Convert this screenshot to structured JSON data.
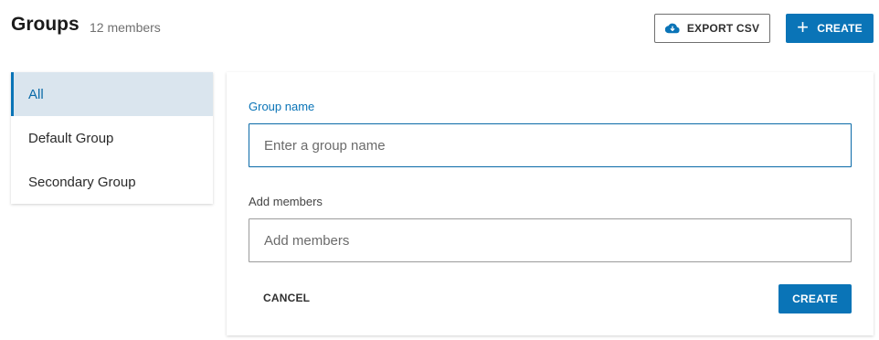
{
  "header": {
    "title": "Groups",
    "member_count": "12 members",
    "export_label": "EXPORT CSV",
    "export_icon": "cloud-download-icon",
    "create_label": "CREATE",
    "create_icon": "plus-icon"
  },
  "sidebar": {
    "items": [
      {
        "label": "All",
        "active": true
      },
      {
        "label": "Default Group",
        "active": false
      },
      {
        "label": "Secondary Group",
        "active": false
      }
    ]
  },
  "form": {
    "group_name_label": "Group name",
    "group_name_placeholder": "Enter a group name",
    "group_name_value": "",
    "members_label": "Add members",
    "members_placeholder": "Add members",
    "members_value": "",
    "cancel_label": "CANCEL",
    "create_label": "CREATE"
  },
  "colors": {
    "accent": "#0a74b7",
    "active_bg": "#dae5ee"
  }
}
